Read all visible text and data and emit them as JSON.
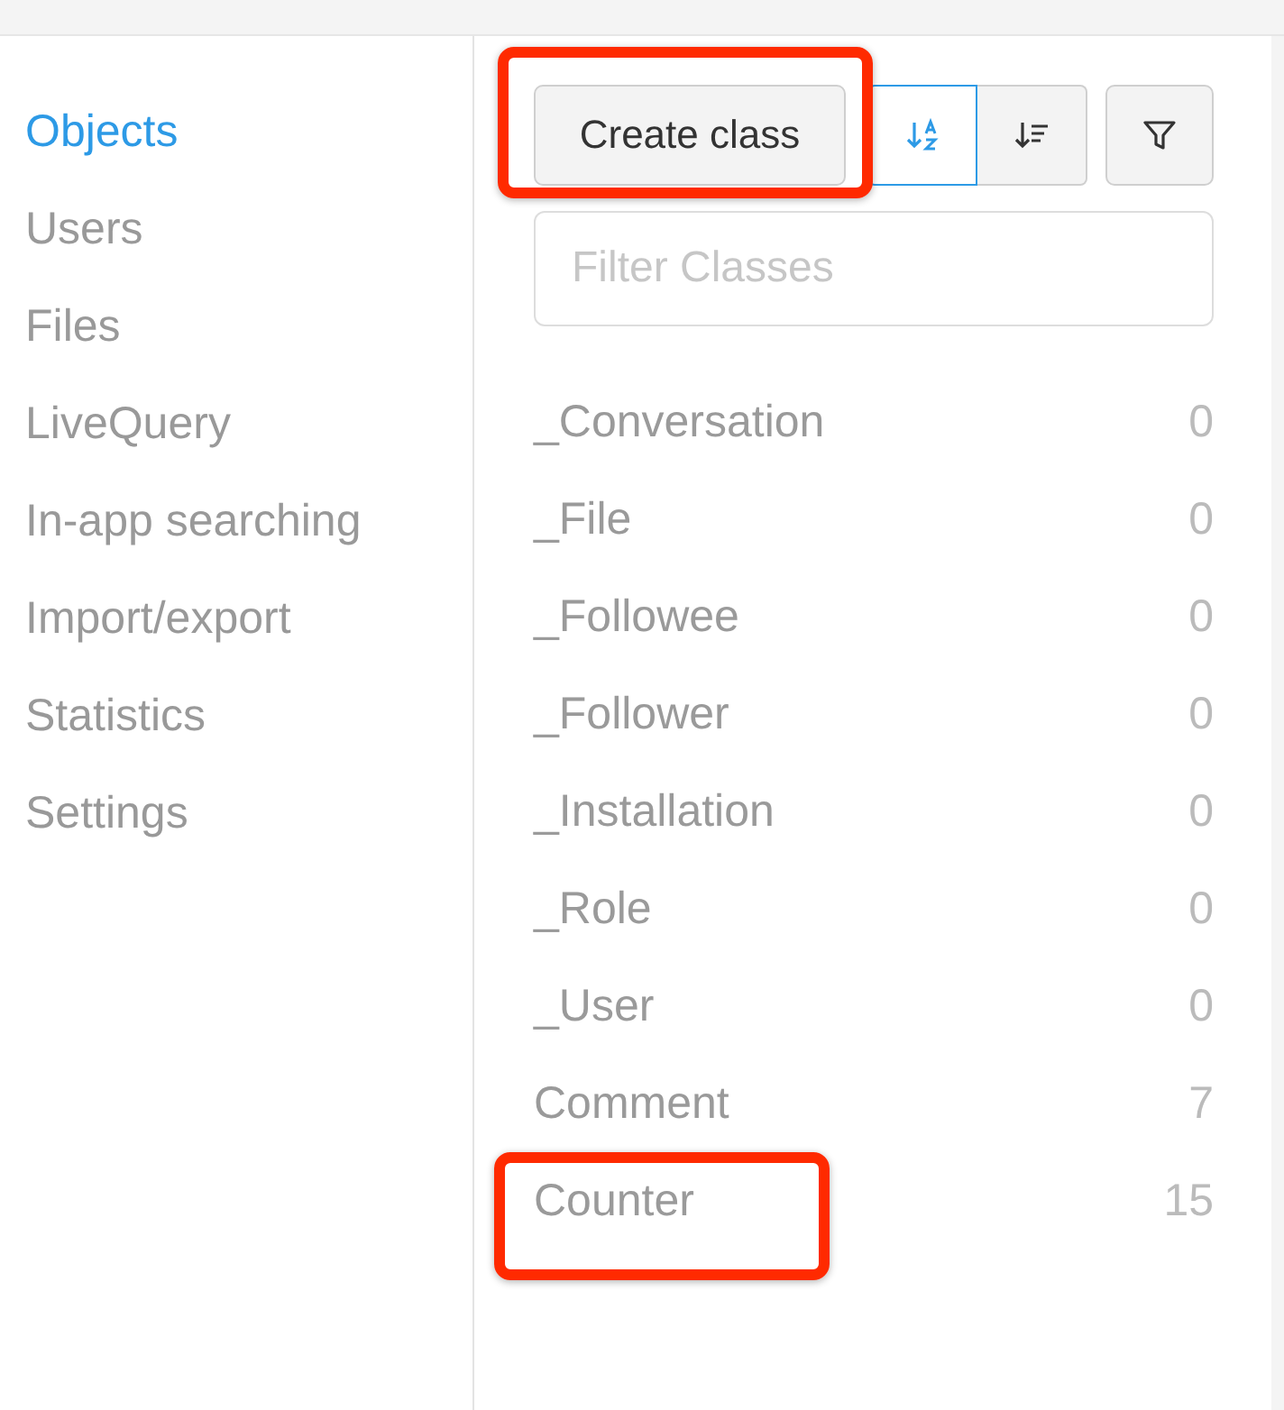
{
  "sidebar": {
    "items": [
      {
        "label": "Objects",
        "selected": true
      },
      {
        "label": "Users",
        "selected": false
      },
      {
        "label": "Files",
        "selected": false
      },
      {
        "label": "LiveQuery",
        "selected": false
      },
      {
        "label": "In-app searching",
        "selected": false
      },
      {
        "label": "Import/export",
        "selected": false
      },
      {
        "label": "Statistics",
        "selected": false
      },
      {
        "label": "Settings",
        "selected": false
      }
    ]
  },
  "toolbar": {
    "create_button": {
      "label": "Create class",
      "highlighted": true
    },
    "sort_buttons": [
      {
        "kind": "alpha",
        "selected": true
      },
      {
        "kind": "count",
        "selected": false
      }
    ],
    "filter_button": {
      "kind": "filter"
    }
  },
  "filter_field": {
    "placeholder": "Filter Classes"
  },
  "classes": [
    {
      "name": "_Conversation",
      "count": "0",
      "highlighted": false
    },
    {
      "name": "_File",
      "count": "0",
      "highlighted": false
    },
    {
      "name": "_Followee",
      "count": "0",
      "highlighted": false
    },
    {
      "name": "_Follower",
      "count": "0",
      "highlighted": false
    },
    {
      "name": "_Installation",
      "count": "0",
      "highlighted": false
    },
    {
      "name": "_Role",
      "count": "0",
      "highlighted": false
    },
    {
      "name": "_User",
      "count": "0",
      "highlighted": false
    },
    {
      "name": "Comment",
      "count": "7",
      "highlighted": false
    },
    {
      "name": "Counter",
      "count": "15",
      "highlighted": true
    }
  ]
}
